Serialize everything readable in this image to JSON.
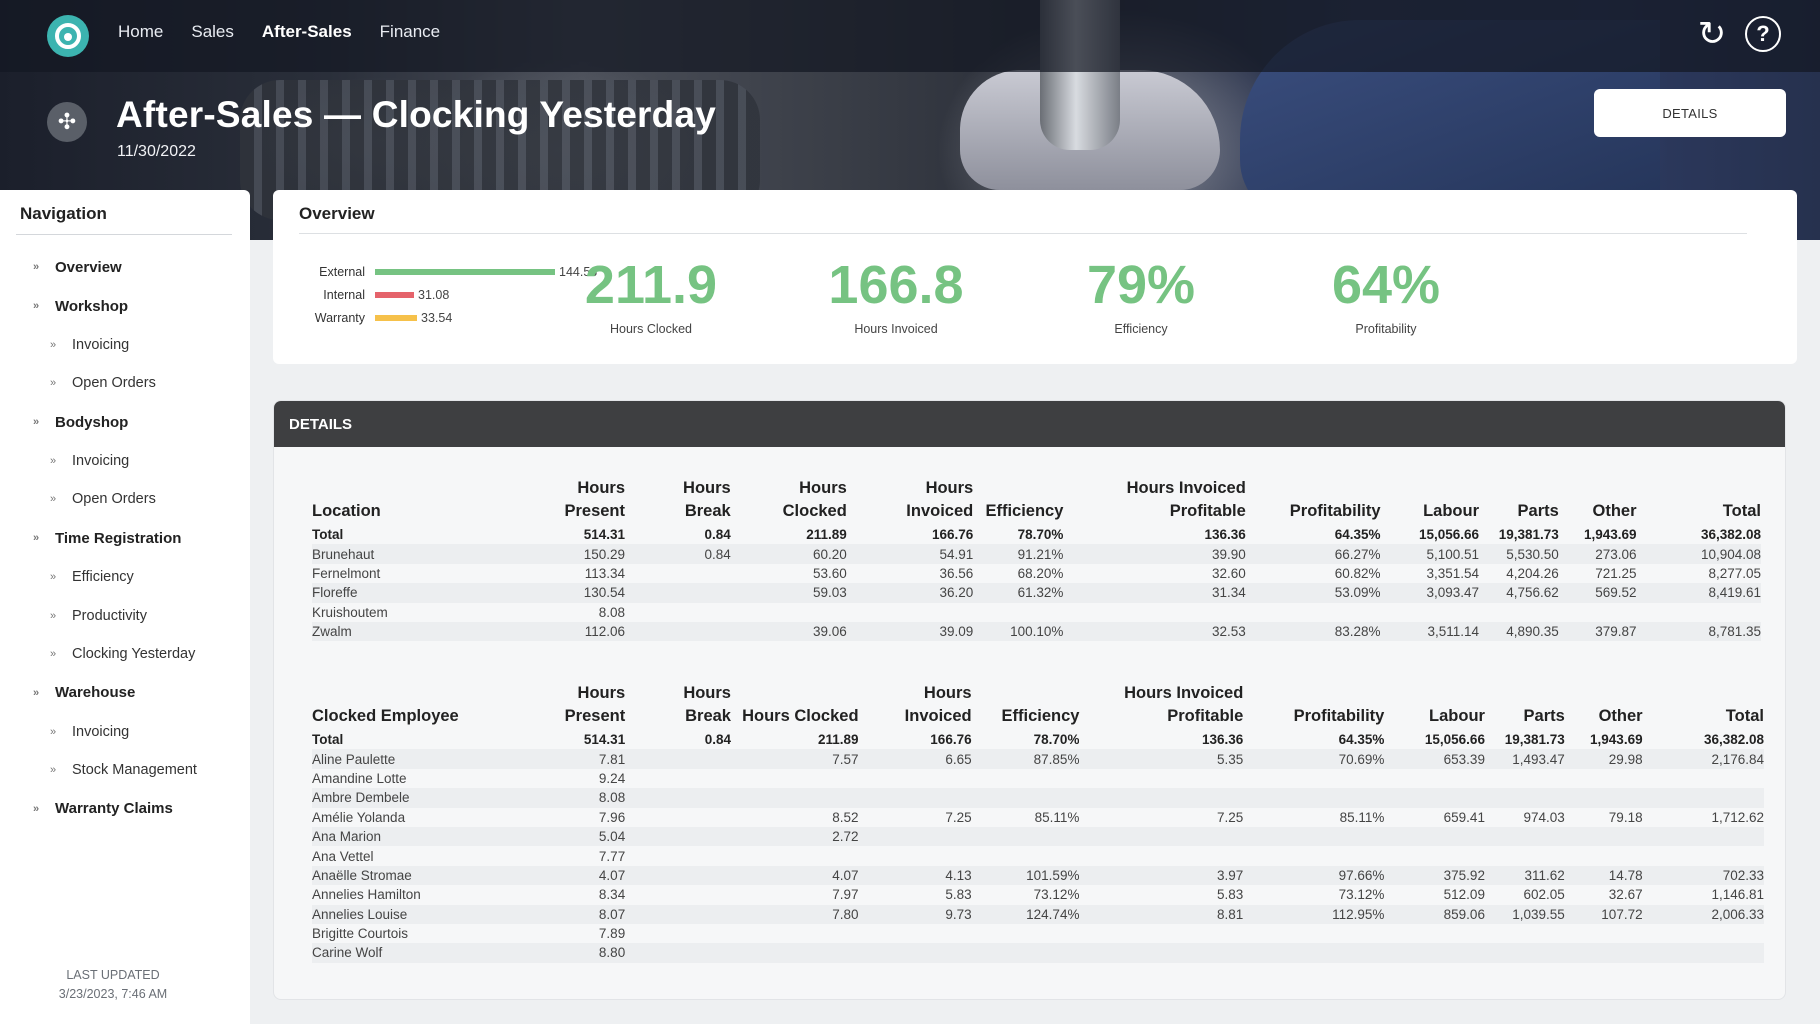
{
  "topnav": {
    "links": [
      "Home",
      "Sales",
      "After-Sales",
      "Finance"
    ],
    "active": "After-Sales"
  },
  "header": {
    "title": "After-Sales — Clocking Yesterday",
    "date": "11/30/2022",
    "details_label": "DETAILS"
  },
  "sidebar": {
    "title": "Navigation",
    "items": [
      {
        "label": "Overview",
        "level": 1
      },
      {
        "label": "Workshop",
        "level": 1
      },
      {
        "label": "Invoicing",
        "level": 2
      },
      {
        "label": "Open Orders",
        "level": 2
      },
      {
        "label": "Bodyshop",
        "level": 1
      },
      {
        "label": "Invoicing",
        "level": 2
      },
      {
        "label": "Open Orders",
        "level": 2
      },
      {
        "label": "Time Registration",
        "level": 1
      },
      {
        "label": "Efficiency",
        "level": 2
      },
      {
        "label": "Productivity",
        "level": 2
      },
      {
        "label": "Clocking Yesterday",
        "level": 2
      },
      {
        "label": "Warehouse",
        "level": 1
      },
      {
        "label": "Invoicing",
        "level": 2
      },
      {
        "label": "Stock Management",
        "level": 2
      },
      {
        "label": "Warranty Claims",
        "level": 1
      }
    ],
    "updated_label": "LAST UPDATED",
    "updated_value": "3/23/2023, 7:46 AM"
  },
  "overview": {
    "title": "Overview",
    "bars": [
      {
        "label": "External",
        "value": 144.56,
        "display": "144.56",
        "color": "#76c382"
      },
      {
        "label": "Internal",
        "value": 31.08,
        "display": "31.08",
        "color": "#e5636b"
      },
      {
        "label": "Warranty",
        "value": 33.54,
        "display": "33.54",
        "color": "#f6c14a"
      }
    ],
    "kpis": [
      {
        "value": "211.9",
        "label": "Hours Clocked"
      },
      {
        "value": "166.8",
        "label": "Hours Invoiced"
      },
      {
        "value": "79%",
        "label": "Efficiency"
      },
      {
        "value": "64%",
        "label": "Profitability"
      }
    ]
  },
  "details": {
    "title": "DETAILS",
    "location_table": {
      "headers": [
        [
          "Location"
        ],
        [
          "Hours",
          "Present"
        ],
        [
          "Hours",
          "Break"
        ],
        [
          "Hours",
          "Clocked"
        ],
        [
          "Hours",
          "Invoiced"
        ],
        [
          "Efficiency"
        ],
        [
          "Hours Invoiced",
          "Profitable"
        ],
        [
          "Profitability"
        ],
        [
          "Labour"
        ],
        [
          "Parts"
        ],
        [
          "Other"
        ],
        [
          "Total"
        ]
      ],
      "rows": [
        [
          "Total",
          "514.31",
          "0.84",
          "211.89",
          "166.76",
          "78.70%",
          "136.36",
          "64.35%",
          "15,056.66",
          "19,381.73",
          "1,943.69",
          "36,382.08"
        ],
        [
          "Brunehaut",
          "150.29",
          "0.84",
          "60.20",
          "54.91",
          "91.21%",
          "39.90",
          "66.27%",
          "5,100.51",
          "5,530.50",
          "273.06",
          "10,904.08"
        ],
        [
          "Fernelmont",
          "113.34",
          "",
          "53.60",
          "36.56",
          "68.20%",
          "32.60",
          "60.82%",
          "3,351.54",
          "4,204.26",
          "721.25",
          "8,277.05"
        ],
        [
          "Floreffe",
          "130.54",
          "",
          "59.03",
          "36.20",
          "61.32%",
          "31.34",
          "53.09%",
          "3,093.47",
          "4,756.62",
          "569.52",
          "8,419.61"
        ],
        [
          "Kruishoutem",
          "8.08",
          "",
          "",
          "",
          "",
          "",
          "",
          "",
          "",
          "",
          ""
        ],
        [
          "Zwalm",
          "112.06",
          "",
          "39.06",
          "39.09",
          "100.10%",
          "32.53",
          "83.28%",
          "3,511.14",
          "4,890.35",
          "379.87",
          "8,781.35"
        ]
      ]
    },
    "employee_table": {
      "headers": [
        [
          "Clocked Employee"
        ],
        [
          "Hours",
          "Present"
        ],
        [
          "Hours",
          "Break"
        ],
        [
          "Hours Clocked"
        ],
        [
          "Hours",
          "Invoiced"
        ],
        [
          "Efficiency"
        ],
        [
          "Hours Invoiced",
          "Profitable"
        ],
        [
          "Profitability"
        ],
        [
          "Labour"
        ],
        [
          "Parts"
        ],
        [
          "Other"
        ],
        [
          "Total"
        ]
      ],
      "rows": [
        [
          "Total",
          "514.31",
          "0.84",
          "211.89",
          "166.76",
          "78.70%",
          "136.36",
          "64.35%",
          "15,056.66",
          "19,381.73",
          "1,943.69",
          "36,382.08"
        ],
        [
          "Aline Paulette",
          "7.81",
          "",
          "7.57",
          "6.65",
          "87.85%",
          "5.35",
          "70.69%",
          "653.39",
          "1,493.47",
          "29.98",
          "2,176.84"
        ],
        [
          "Amandine Lotte",
          "9.24",
          "",
          "",
          "",
          "",
          "",
          "",
          "",
          "",
          "",
          ""
        ],
        [
          "Ambre Dembele",
          "8.08",
          "",
          "",
          "",
          "",
          "",
          "",
          "",
          "",
          "",
          ""
        ],
        [
          "Amélie Yolanda",
          "7.96",
          "",
          "8.52",
          "7.25",
          "85.11%",
          "7.25",
          "85.11%",
          "659.41",
          "974.03",
          "79.18",
          "1,712.62"
        ],
        [
          "Ana Marion",
          "5.04",
          "",
          "2.72",
          "",
          "",
          "",
          "",
          "",
          "",
          "",
          ""
        ],
        [
          "Ana Vettel",
          "7.77",
          "",
          "",
          "",
          "",
          "",
          "",
          "",
          "",
          "",
          ""
        ],
        [
          "Anaëlle Stromae",
          "4.07",
          "",
          "4.07",
          "4.13",
          "101.59%",
          "3.97",
          "97.66%",
          "375.92",
          "311.62",
          "14.78",
          "702.33"
        ],
        [
          "Annelies Hamilton",
          "8.34",
          "",
          "7.97",
          "5.83",
          "73.12%",
          "5.83",
          "73.12%",
          "512.09",
          "602.05",
          "32.67",
          "1,146.81"
        ],
        [
          "Annelies Louise",
          "8.07",
          "",
          "7.80",
          "9.73",
          "124.74%",
          "8.81",
          "112.95%",
          "859.06",
          "1,039.55",
          "107.72",
          "2,006.33"
        ],
        [
          "Brigitte Courtois",
          "7.89",
          "",
          "",
          "",
          "",
          "",
          "",
          "",
          "",
          "",
          ""
        ],
        [
          "Carine Wolf",
          "8.80",
          "",
          "",
          "",
          "",
          "",
          "",
          "",
          "",
          "",
          ""
        ]
      ]
    }
  }
}
